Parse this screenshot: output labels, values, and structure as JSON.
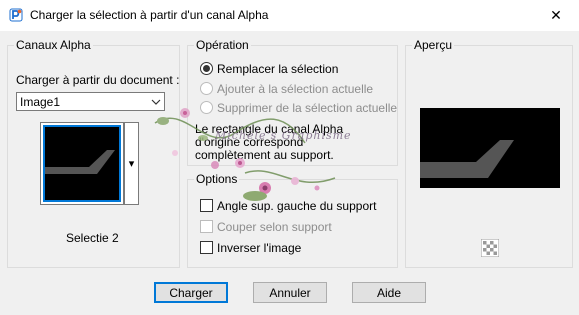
{
  "window": {
    "title": "Charger la sélection à partir d'un canal Alpha",
    "close_glyph": "✕",
    "icon": "app-logo-icon"
  },
  "canaux": {
    "group_label": "Canaux Alpha",
    "doc_label": "Charger à partir du document :",
    "doc_value": "Image1",
    "dropdown_glyph": "⌵",
    "channel_dropdown_glyph": "▾",
    "channel_name": "Selectie 2"
  },
  "operation": {
    "group_label": "Opération",
    "options": [
      {
        "label": "Remplacer la sélection",
        "selected": true,
        "enabled": true
      },
      {
        "label": "Ajouter à la sélection actuelle",
        "selected": false,
        "enabled": false
      },
      {
        "label": "Supprimer de la sélection actuelle",
        "selected": false,
        "enabled": false
      }
    ],
    "info_line1": "Le rectangle du canal Alpha",
    "info_line2": "d'origine correspond",
    "info_line3": "complètement au support."
  },
  "options": {
    "group_label": "Options",
    "items": [
      {
        "label": "Angle sup. gauche du support",
        "checked": false,
        "enabled": true
      },
      {
        "label": "Couper selon support",
        "checked": false,
        "enabled": false
      },
      {
        "label": "Inverser l'image",
        "checked": false,
        "enabled": true
      }
    ]
  },
  "apercu": {
    "group_label": "Aperçu",
    "pan_icon": "checkerboard-icon"
  },
  "watermark": {
    "text": "Michèle's Graphisme"
  },
  "buttons": {
    "ok": "Charger",
    "cancel": "Annuler",
    "help": "Aide"
  },
  "colors": {
    "accent": "#0078d7",
    "thumb_bg": "#000000",
    "thumb_shape": "#555555"
  }
}
